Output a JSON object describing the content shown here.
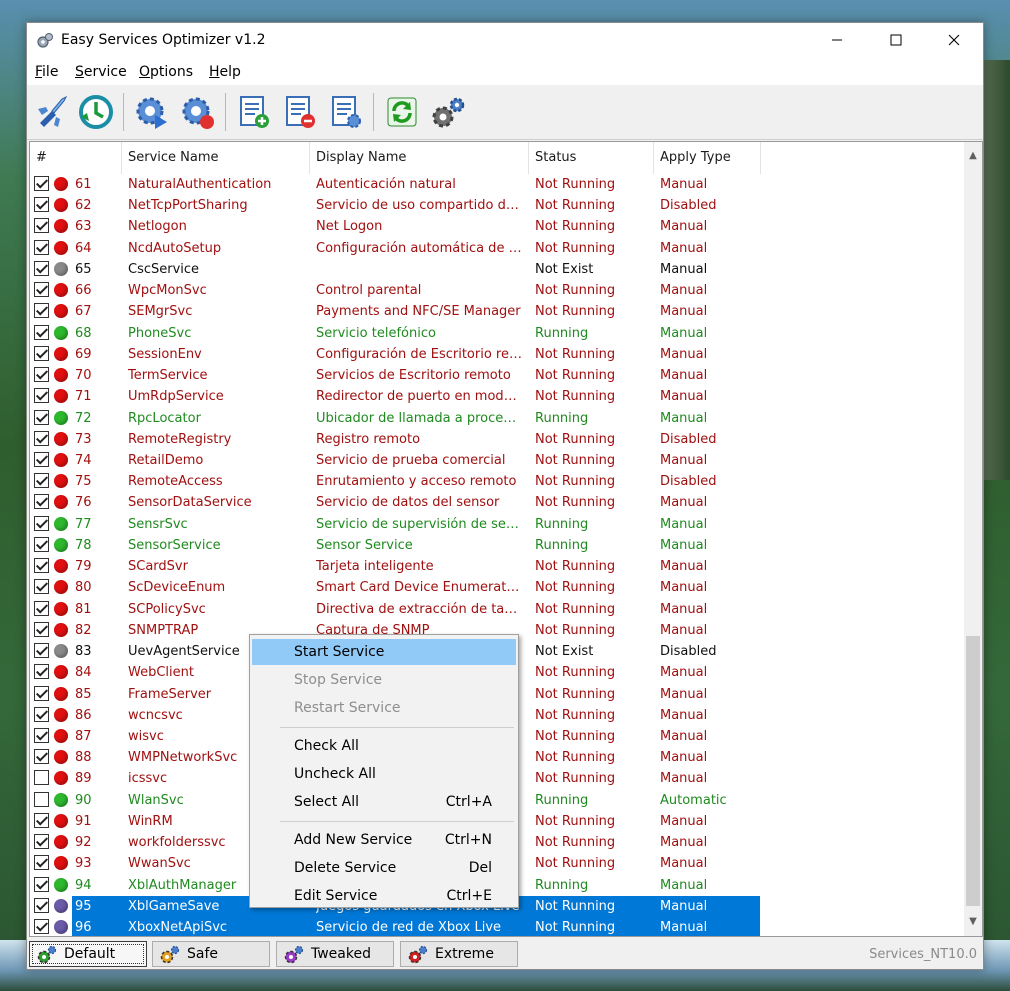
{
  "window": {
    "title": "Easy Services Optimizer v1.2"
  },
  "menu": [
    {
      "label": "File",
      "key": "F",
      "rest": "ile"
    },
    {
      "label": "Service",
      "key": "S",
      "rest": "ervice"
    },
    {
      "label": "Options",
      "key": "O",
      "rest": "ptions"
    },
    {
      "label": "Help",
      "key": "H",
      "rest": "elp"
    }
  ],
  "toolbar": [
    "optimize-icon",
    "restore-icon",
    "start-service-icon",
    "stop-service-icon",
    "add-list-icon",
    "delete-list-icon",
    "edit-list-icon",
    "refresh-icon",
    "settings-icon"
  ],
  "columns": {
    "num": "#",
    "service_name": "Service Name",
    "display_name": "Display Name",
    "status": "Status",
    "apply_type": "Apply Type"
  },
  "colors": {
    "red": "#a01010",
    "green": "#1f8a1f",
    "black": "#111111",
    "dot_red": "#e01010",
    "dot_green": "#2eb82e",
    "dot_gray": "#8a8a8a",
    "dot_purple": "#6a5aa8",
    "selection": "#0078d7"
  },
  "rows": [
    {
      "checked": true,
      "num": "61",
      "service": "NaturalAuthentication",
      "display": "Autenticación natural",
      "status": "Not Running",
      "type": "Manual",
      "color": "red"
    },
    {
      "checked": true,
      "num": "62",
      "service": "NetTcpPortSharing",
      "display": "Servicio de uso compartido de …",
      "status": "Not Running",
      "type": "Disabled",
      "color": "red"
    },
    {
      "checked": true,
      "num": "63",
      "service": "Netlogon",
      "display": "Net Logon",
      "status": "Not Running",
      "type": "Manual",
      "color": "red"
    },
    {
      "checked": true,
      "num": "64",
      "service": "NcdAutoSetup",
      "display": "Configuración automática de di…",
      "status": "Not Running",
      "type": "Manual",
      "color": "red"
    },
    {
      "checked": true,
      "num": "65",
      "service": "CscService",
      "display": "",
      "status": "Not Exist",
      "type": "Manual",
      "color": "black"
    },
    {
      "checked": true,
      "num": "66",
      "service": "WpcMonSvc",
      "display": "Control parental",
      "status": "Not Running",
      "type": "Manual",
      "color": "red"
    },
    {
      "checked": true,
      "num": "67",
      "service": "SEMgrSvc",
      "display": "Payments and NFC/SE Manager",
      "status": "Not Running",
      "type": "Manual",
      "color": "red"
    },
    {
      "checked": true,
      "num": "68",
      "service": "PhoneSvc",
      "display": "Servicio telefónico",
      "status": "Running",
      "type": "Manual",
      "color": "green"
    },
    {
      "checked": true,
      "num": "69",
      "service": "SessionEnv",
      "display": "Configuración de Escritorio rem…",
      "status": "Not Running",
      "type": "Manual",
      "color": "red"
    },
    {
      "checked": true,
      "num": "70",
      "service": "TermService",
      "display": "Servicios de Escritorio remoto",
      "status": "Not Running",
      "type": "Manual",
      "color": "red"
    },
    {
      "checked": true,
      "num": "71",
      "service": "UmRdpService",
      "display": "Redirector de puerto en modo …",
      "status": "Not Running",
      "type": "Manual",
      "color": "red"
    },
    {
      "checked": true,
      "num": "72",
      "service": "RpcLocator",
      "display": "Ubicador de llamada a procedim…",
      "status": "Running",
      "type": "Manual",
      "color": "green"
    },
    {
      "checked": true,
      "num": "73",
      "service": "RemoteRegistry",
      "display": "Registro remoto",
      "status": "Not Running",
      "type": "Disabled",
      "color": "red"
    },
    {
      "checked": true,
      "num": "74",
      "service": "RetailDemo",
      "display": "Servicio de prueba comercial",
      "status": "Not Running",
      "type": "Manual",
      "color": "red"
    },
    {
      "checked": true,
      "num": "75",
      "service": "RemoteAccess",
      "display": "Enrutamiento y acceso remoto",
      "status": "Not Running",
      "type": "Disabled",
      "color": "red"
    },
    {
      "checked": true,
      "num": "76",
      "service": "SensorDataService",
      "display": "Servicio de datos del sensor",
      "status": "Not Running",
      "type": "Manual",
      "color": "red"
    },
    {
      "checked": true,
      "num": "77",
      "service": "SensrSvc",
      "display": "Servicio de supervisión de sens…",
      "status": "Running",
      "type": "Manual",
      "color": "green"
    },
    {
      "checked": true,
      "num": "78",
      "service": "SensorService",
      "display": "Sensor Service",
      "status": "Running",
      "type": "Manual",
      "color": "green"
    },
    {
      "checked": true,
      "num": "79",
      "service": "SCardSvr",
      "display": "Tarjeta inteligente",
      "status": "Not Running",
      "type": "Manual",
      "color": "red"
    },
    {
      "checked": true,
      "num": "80",
      "service": "ScDeviceEnum",
      "display": "Smart Card Device Enumeratio…",
      "status": "Not Running",
      "type": "Manual",
      "color": "red"
    },
    {
      "checked": true,
      "num": "81",
      "service": "SCPolicySvc",
      "display": "Directiva de extracción de tarje…",
      "status": "Not Running",
      "type": "Manual",
      "color": "red"
    },
    {
      "checked": true,
      "num": "82",
      "service": "SNMPTRAP",
      "display": "Captura de SNMP",
      "status": "Not Running",
      "type": "Manual",
      "color": "red"
    },
    {
      "checked": true,
      "num": "83",
      "service": "UevAgentService",
      "display": "",
      "status": "Not Exist",
      "type": "Disabled",
      "color": "black"
    },
    {
      "checked": true,
      "num": "84",
      "service": "WebClient",
      "display": "",
      "status": "Not Running",
      "type": "Manual",
      "color": "red"
    },
    {
      "checked": true,
      "num": "85",
      "service": "FrameServer",
      "display": "",
      "status": "Not Running",
      "type": "Manual",
      "color": "red"
    },
    {
      "checked": true,
      "num": "86",
      "service": "wcncsvc",
      "display": "",
      "status": "Not Running",
      "type": "Manual",
      "color": "red"
    },
    {
      "checked": true,
      "num": "87",
      "service": "wisvc",
      "display": "",
      "status": "Not Running",
      "type": "Manual",
      "color": "red"
    },
    {
      "checked": true,
      "num": "88",
      "service": "WMPNetworkSvc",
      "display": "",
      "status": "Not Running",
      "type": "Manual",
      "color": "red"
    },
    {
      "checked": false,
      "num": "89",
      "service": "icssvc",
      "display": "",
      "status": "Not Running",
      "type": "Manual",
      "color": "red"
    },
    {
      "checked": false,
      "num": "90",
      "service": "WlanSvc",
      "display": "",
      "status": "Running",
      "type": "Automatic",
      "color": "green"
    },
    {
      "checked": true,
      "num": "91",
      "service": "WinRM",
      "display": "",
      "status": "Not Running",
      "type": "Manual",
      "color": "red"
    },
    {
      "checked": true,
      "num": "92",
      "service": "workfolderssvc",
      "display": "",
      "status": "Not Running",
      "type": "Manual",
      "color": "red"
    },
    {
      "checked": true,
      "num": "93",
      "service": "WwanSvc",
      "display": "",
      "status": "Not Running",
      "type": "Manual",
      "color": "red"
    },
    {
      "checked": true,
      "num": "94",
      "service": "XblAuthManager",
      "display": "",
      "status": "Running",
      "type": "Manual",
      "color": "green"
    },
    {
      "checked": true,
      "num": "95",
      "service": "XblGameSave",
      "display": "Juegos guardados en Xbox Live",
      "status": "Not Running",
      "type": "Manual",
      "color": "purple",
      "selected": true
    },
    {
      "checked": true,
      "num": "96",
      "service": "XboxNetApiSvc",
      "display": "Servicio de red de Xbox Live",
      "status": "Not Running",
      "type": "Manual",
      "color": "purple",
      "selected": true
    }
  ],
  "context_menu": [
    {
      "label": "Start Service",
      "shortcut": "",
      "state": "highlighted"
    },
    {
      "label": "Stop Service",
      "shortcut": "",
      "state": "disabled"
    },
    {
      "label": "Restart Service",
      "shortcut": "",
      "state": "disabled"
    },
    {
      "separator": true
    },
    {
      "label": "Check All",
      "shortcut": "",
      "state": "normal"
    },
    {
      "label": "Uncheck All",
      "shortcut": "",
      "state": "normal"
    },
    {
      "label": "Select All",
      "shortcut": "Ctrl+A",
      "state": "normal"
    },
    {
      "separator": true
    },
    {
      "label": "Add New Service",
      "shortcut": "Ctrl+N",
      "state": "normal"
    },
    {
      "label": "Delete Service",
      "shortcut": "Del",
      "state": "normal"
    },
    {
      "label": "Edit Service",
      "shortcut": "Ctrl+E",
      "state": "normal"
    }
  ],
  "presets": [
    {
      "label": "Default",
      "icon_color": "#2e9e2e",
      "active": true
    },
    {
      "label": "Safe",
      "icon_color": "#e0a020",
      "active": false
    },
    {
      "label": "Tweaked",
      "icon_color": "#9a3cc8",
      "active": false
    },
    {
      "label": "Extreme",
      "icon_color": "#d02020",
      "active": false
    }
  ],
  "status_bar": {
    "profile": "Services_NT10.0"
  }
}
